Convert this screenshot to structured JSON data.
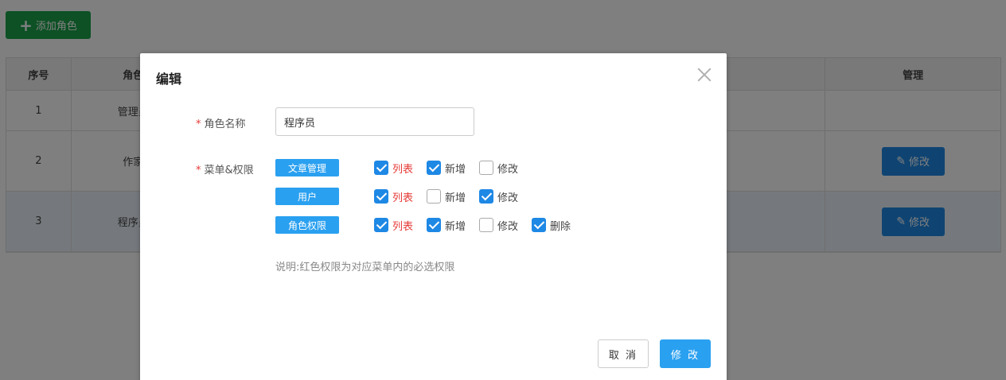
{
  "toolbar": {
    "add_role_label": "添加角色"
  },
  "table": {
    "headers": {
      "index": "序号",
      "role": "角色",
      "manage": "管理"
    },
    "rows": [
      {
        "index": "1",
        "role": "管理员",
        "action": ""
      },
      {
        "index": "2",
        "role": "作家",
        "action": "修改"
      },
      {
        "index": "3",
        "role": "程序员",
        "action": "修改"
      }
    ]
  },
  "dialog": {
    "title": "编辑",
    "role_name_label": "角色名称",
    "role_name_value": "程序员",
    "menu_perm_label": "菜单&权限",
    "required_mark": "*",
    "menus": [
      {
        "name": "文章管理",
        "permissions": [
          {
            "label": "列表",
            "checked": true,
            "required": true
          },
          {
            "label": "新增",
            "checked": true,
            "required": false
          },
          {
            "label": "修改",
            "checked": false,
            "required": false
          }
        ]
      },
      {
        "name": "用户",
        "permissions": [
          {
            "label": "列表",
            "checked": true,
            "required": true
          },
          {
            "label": "新增",
            "checked": false,
            "required": false
          },
          {
            "label": "修改",
            "checked": true,
            "required": false
          }
        ]
      },
      {
        "name": "角色权限",
        "permissions": [
          {
            "label": "列表",
            "checked": true,
            "required": true
          },
          {
            "label": "新增",
            "checked": true,
            "required": false
          },
          {
            "label": "修改",
            "checked": false,
            "required": false
          },
          {
            "label": "删除",
            "checked": true,
            "required": false
          }
        ]
      }
    ],
    "note": "说明:红色权限为对应菜单内的必选权限",
    "cancel_label": "取 消",
    "confirm_label": "修 改"
  },
  "colors": {
    "primary": "#2aa0f0",
    "add_green": "#1aa34a",
    "required_red": "#e53935"
  },
  "icons": {
    "add": "plus-icon",
    "edit": "pencil-icon",
    "close": "close-icon"
  }
}
